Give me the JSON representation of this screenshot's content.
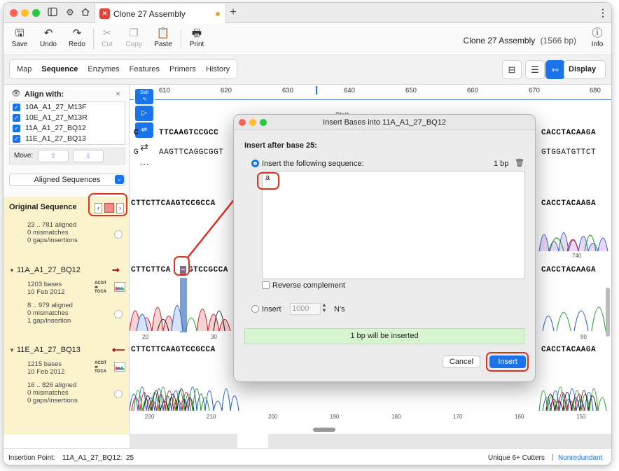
{
  "app": {
    "tab_title": "Clone 27 Assembly",
    "assembly_title": "Clone 27 Assembly",
    "assembly_length": "(1566 bp)"
  },
  "toolbar": {
    "save": "Save",
    "undo": "Undo",
    "redo": "Redo",
    "cut": "Cut",
    "copy": "Copy",
    "paste": "Paste",
    "print": "Print",
    "info": "Info"
  },
  "view_tabs": [
    "Map",
    "Sequence",
    "Enzymes",
    "Features",
    "Primers",
    "History"
  ],
  "display_label": "Display",
  "align_panel": {
    "header": "Align with:",
    "items": [
      "10A_A1_27_M13F",
      "10E_A1_27_M13R",
      "11A_A1_27_BQ12",
      "11E_A1_27_BQ13"
    ],
    "move_label": "Move:",
    "selector": "Aligned Sequences"
  },
  "ruler": [
    "610",
    "620",
    "630",
    "640",
    "650",
    "660",
    "670",
    "680"
  ],
  "upper_seq": {
    "enzyme": "PfoI*",
    "sali": "SalI",
    "top_left": "C",
    "top_mid": "TTCAAGTCCGCC",
    "top_right": "CACCTACAAGA",
    "bot_left": "G",
    "bot_mid": "AAGTTCAGGCGGT",
    "bot_right": "GTGGATGTTCT"
  },
  "tracks": {
    "original": {
      "name": "Original Sequence",
      "line1": "23 .. 781 aligned",
      "line2": "0 mismatches",
      "line3": "0 gaps/insertions",
      "seq_left": "CTTCTTCAAGTCCGCCA",
      "seq_right": "CACCTACAAGA",
      "tick_right": "740"
    },
    "bq12": {
      "name": "11A_A1_27_BQ12",
      "bases": "1203 bases",
      "date": "10 Feb 2012",
      "line1": "8 .. 979 aligned",
      "line2": "0 mismatches",
      "line3": "1 gap/insertion",
      "seq_left_a": "CTTCTTCA",
      "gap": "–",
      "seq_left_b": "GTCCGCCA",
      "seq_right": "CACCTACAAGA",
      "ticks": [
        "20",
        "30",
        "90"
      ]
    },
    "bq13": {
      "name": "11E_A1_27_BQ13",
      "bases": "1215 bases",
      "date": "10 Feb 2012",
      "line1": "16 .. 826 aligned",
      "line2": "0 mismatches",
      "line3": "0 gaps/insertions",
      "seq_left": "CTTCTTCAAGTCCGCCA",
      "seq_right": "CACCTACAAGA",
      "ticks": [
        "220",
        "210",
        "200",
        "190",
        "180",
        "170",
        "160",
        "150"
      ]
    },
    "acgt": "ACGT",
    "tgca": "TGCA"
  },
  "status": {
    "insertion_label": "Insertion Point:",
    "insertion_value": "11A_A1_27_BQ12:  25",
    "cutters": "Unique 6+ Cutters",
    "separator": "|",
    "mode": "Nonredundant"
  },
  "dialog": {
    "title": "Insert Bases into 11A_A1_27_BQ12",
    "heading": "Insert after base 25:",
    "option_sequence": "Insert the following sequence:",
    "bp_count": "1 bp",
    "sequence_value": "a",
    "reverse_complement": "Reverse complement",
    "option_insert": "Insert",
    "n_count_placeholder": "1000",
    "ns_label": "N's",
    "message": "1 bp will be inserted",
    "cancel": "Cancel",
    "insert": "Insert"
  },
  "colors": {
    "accent": "#1a73e8",
    "highlight": "#e0301e",
    "message_bg": "#d6f5cf",
    "trace_A": "#2aa02a",
    "trace_C": "#1f5fd0",
    "trace_G": "#222222",
    "trace_T": "#d0202a"
  }
}
